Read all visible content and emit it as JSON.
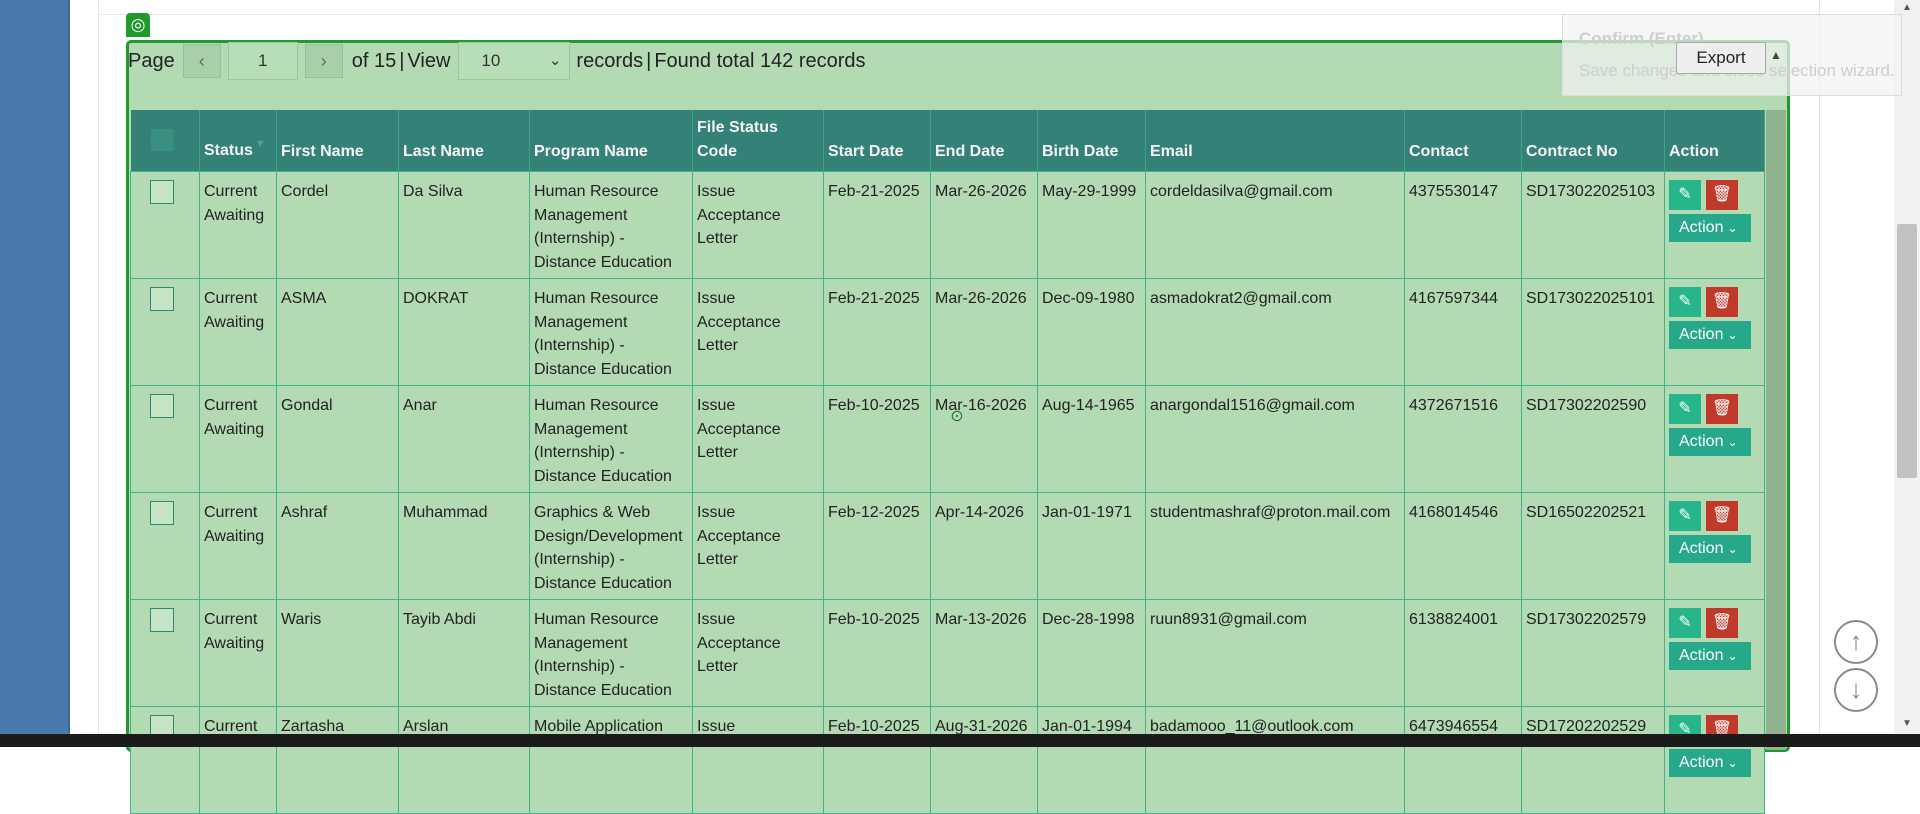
{
  "pager": {
    "page_label": "Page",
    "prev_icon": "chevron-left-icon",
    "current_page": "1",
    "next_icon": "chevron-right-icon",
    "of_label": "of 15",
    "separator": "|",
    "view_label": "View",
    "view_value": "10",
    "records_label": "records",
    "found_label": "Found total 142 records"
  },
  "export_label": "Export",
  "confirm_tip": {
    "title": "Confirm (Enter)",
    "description": "Save changes and close selection wizard."
  },
  "table": {
    "headers": [
      "Status",
      "First Name",
      "Last Name",
      "Program Name",
      "File Status Code",
      "Start Date",
      "End Date",
      "Birth Date",
      "Email",
      "Contact",
      "Contract No",
      "Action"
    ],
    "action_label": "Action",
    "rows": [
      {
        "status": "Current Awaiting",
        "first": "Cordel",
        "last": "Da Silva",
        "program": "Human Resource Management (Internship) - Distance Education",
        "file_status": "Issue Acceptance Letter",
        "start": "Feb-21-2025",
        "end": "Mar-26-2026",
        "birth": "May-29-1999",
        "email": "cordeldasilva@gmail.com",
        "contact": "4375530147",
        "contract": "SD173022025103"
      },
      {
        "status": "Current Awaiting",
        "first": "ASMA",
        "last": "DOKRAT",
        "program": "Human Resource Management (Internship) - Distance Education",
        "file_status": "Issue Acceptance Letter",
        "start": "Feb-21-2025",
        "end": "Mar-26-2026",
        "birth": "Dec-09-1980",
        "email": "asmadokrat2@gmail.com",
        "contact": "4167597344",
        "contract": "SD173022025101"
      },
      {
        "status": "Current Awaiting",
        "first": "Gondal",
        "last": "Anar",
        "program": "Human Resource Management (Internship) - Distance Education",
        "file_status": "Issue Acceptance Letter",
        "start": "Feb-10-2025",
        "end": "Mar-16-2026",
        "birth": "Aug-14-1965",
        "email": "anargondal1516@gmail.com",
        "contact": "4372671516",
        "contract": "SD17302202590"
      },
      {
        "status": "Current Awaiting",
        "first": "Ashraf",
        "last": "Muhammad",
        "program": "Graphics & Web Design/Development (Internship) - Distance Education",
        "file_status": "Issue Acceptance Letter",
        "start": "Feb-12-2025",
        "end": "Apr-14-2026",
        "birth": "Jan-01-1971",
        "email": "studentmashraf@proton.mail.com",
        "contact": "4168014546",
        "contract": "SD16502202521"
      },
      {
        "status": "Current Awaiting",
        "first": "Waris",
        "last": "Tayib Abdi",
        "program": "Human Resource Management (Internship) - Distance Education",
        "file_status": "Issue Acceptance Letter",
        "start": "Feb-10-2025",
        "end": "Mar-13-2026",
        "birth": "Dec-28-1998",
        "email": "ruun8931@gmail.com",
        "contact": "6138824001",
        "contract": "SD17302202579"
      },
      {
        "status": "Current",
        "first": "Zartasha",
        "last": "Arslan",
        "program": "Mobile Application",
        "file_status": "Issue",
        "start": "Feb-10-2025",
        "end": "Aug-31-2026",
        "birth": "Jan-01-1994",
        "email": "badamooo_11@outlook.com",
        "contact": "6473946554",
        "contract": "SD17202202529"
      }
    ]
  },
  "icons": {
    "edit": "edit-icon",
    "delete": "trash-icon",
    "scroll_up": "arrow-up-icon",
    "scroll_down": "arrow-down-icon",
    "target": "target-icon"
  },
  "colors": {
    "header_teal": "#348177",
    "overlay_green": "#b3dab3",
    "action_teal": "#26a88a",
    "delete_red": "#c0392b"
  }
}
